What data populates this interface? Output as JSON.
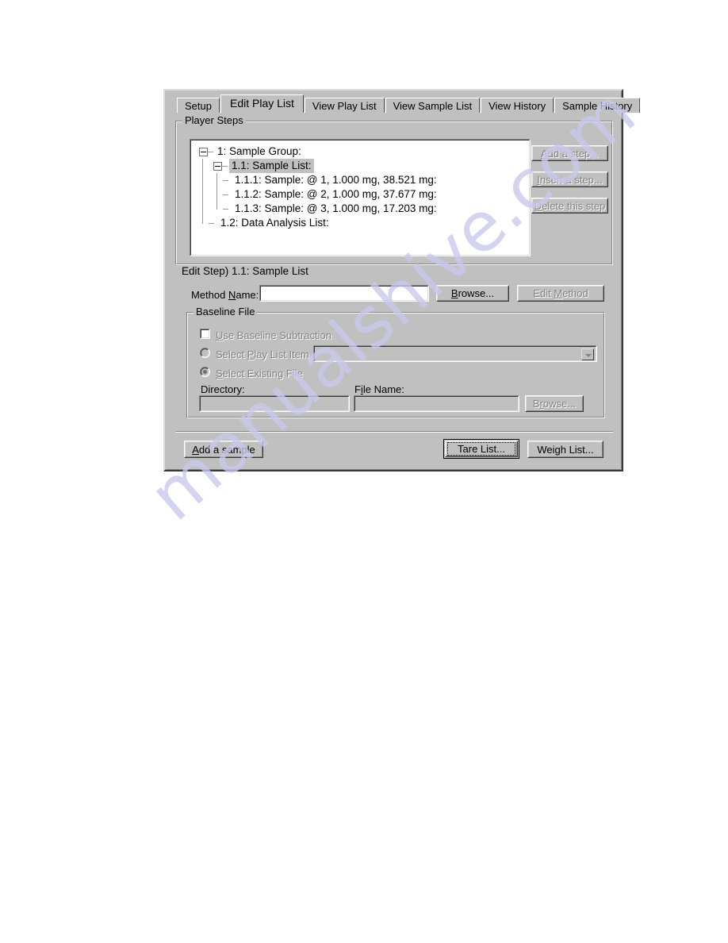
{
  "dialog": {
    "tabs": [
      {
        "label": "Setup",
        "active": false
      },
      {
        "label": "Edit Play List",
        "active": true
      },
      {
        "label": "View Play List",
        "active": false
      },
      {
        "label": "View Sample List",
        "active": false
      },
      {
        "label": "View History",
        "active": false
      },
      {
        "label": "Sample History",
        "active": false
      }
    ],
    "player_steps": {
      "title": "Player Steps",
      "tree": [
        {
          "label": "1: Sample Group:",
          "level": 0,
          "expander": true,
          "selected": false
        },
        {
          "label": "1.1: Sample List:",
          "level": 1,
          "expander": true,
          "selected": true
        },
        {
          "label": "1.1.1: Sample:  @ 1, 1.000 mg, 38.521 mg:",
          "level": 2,
          "expander": false,
          "selected": false
        },
        {
          "label": "1.1.2: Sample:  @ 2, 1.000 mg, 37.677 mg:",
          "level": 2,
          "expander": false,
          "selected": false
        },
        {
          "label": "1.1.3: Sample:  @ 3, 1.000 mg, 17.203 mg:",
          "level": 2,
          "expander": false,
          "selected": false
        },
        {
          "label": "1.2: Data Analysis List:",
          "level": 1,
          "expander": false,
          "selected": false
        }
      ],
      "buttons": {
        "add_step": "Add a step...",
        "insert_step": "Insert a step...",
        "delete_step": "Delete this step"
      }
    },
    "edit_step": {
      "header": "Edit Step)  1.1: Sample List",
      "method_name_label": "Method Name:",
      "method_name_value": "",
      "browse_label": "Browse...",
      "edit_method_label": "Edit Method"
    },
    "baseline_file": {
      "title": "Baseline File",
      "use_baseline_label": "Use Baseline Subtraction",
      "use_baseline_checked": false,
      "select_play_list_item_label": "Select Play List Item",
      "play_list_item_value": "",
      "select_existing_file_label": "Select Existing File",
      "directory_label": "Directory:",
      "directory_value": "",
      "file_name_label": "File Name:",
      "file_name_value": "",
      "browse_label": "Browse..."
    },
    "footer": {
      "add_sample": "Add a sample",
      "tare_list": "Tare List...",
      "weigh_list": "Weigh List..."
    }
  },
  "watermark": {
    "text": "manualshive.com"
  }
}
